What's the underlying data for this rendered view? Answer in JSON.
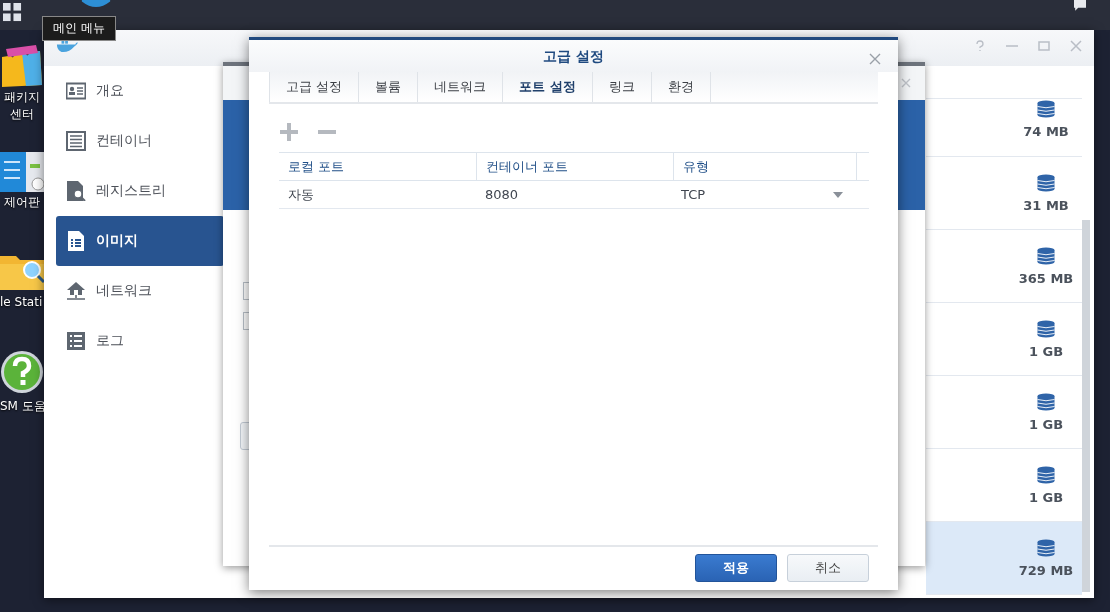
{
  "taskbar": {
    "tooltip": "메인 메뉴"
  },
  "desktop_icons": [
    {
      "kind": "package",
      "label": "패키지 센터"
    },
    {
      "kind": "control",
      "label": "제어판"
    },
    {
      "kind": "folder",
      "label": "le Stati"
    },
    {
      "kind": "help",
      "label": "SM 도움"
    }
  ],
  "docker_window": {
    "sidebar": {
      "items": [
        {
          "kind": "overview",
          "label": "개요",
          "selected": false
        },
        {
          "kind": "container",
          "label": "컨테이너",
          "selected": false
        },
        {
          "kind": "registry",
          "label": "레지스트리",
          "selected": false
        },
        {
          "kind": "image",
          "label": "이미지",
          "selected": true
        },
        {
          "kind": "network",
          "label": "네트워크",
          "selected": false
        },
        {
          "kind": "log",
          "label": "로그",
          "selected": false
        }
      ]
    },
    "image_sizes": [
      {
        "size": "74 MB",
        "selected": false
      },
      {
        "size": "31 MB",
        "selected": false
      },
      {
        "size": "365 MB",
        "selected": false
      },
      {
        "size": "1 GB",
        "selected": false
      },
      {
        "size": "1 GB",
        "selected": false
      },
      {
        "size": "1 GB",
        "selected": false
      },
      {
        "size": "729 MB",
        "selected": true
      }
    ]
  },
  "background_window": {
    "checkboxes": [
      {
        "checked": false
      },
      {
        "checked": false
      }
    ]
  },
  "dialog": {
    "title": "고급 설정",
    "tabs": [
      {
        "label": "고급 설정",
        "selected": false
      },
      {
        "label": "볼륨",
        "selected": false
      },
      {
        "label": "네트워크",
        "selected": false
      },
      {
        "label": "포트 설정",
        "selected": true
      },
      {
        "label": "링크",
        "selected": false
      },
      {
        "label": "환경",
        "selected": false
      }
    ],
    "table": {
      "columns": [
        "로컬 포트",
        "컨테이너 포트",
        "유형"
      ],
      "rows": [
        {
          "local_port": "자동",
          "container_port": "8080",
          "type": "TCP"
        }
      ]
    },
    "buttons": [
      {
        "kind": "primary",
        "label": "적용"
      },
      {
        "kind": "secondary",
        "label": "취소"
      }
    ]
  }
}
